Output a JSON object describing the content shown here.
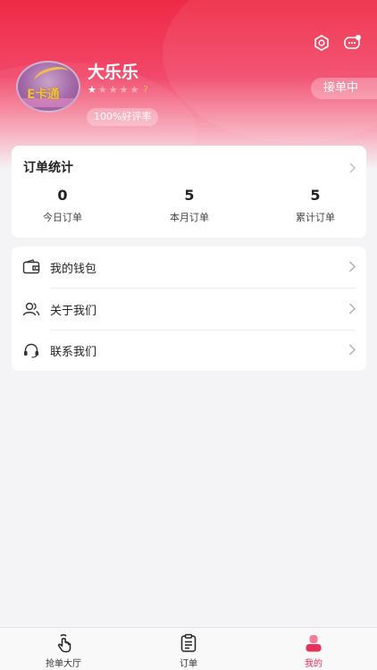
{
  "header": {
    "user_name": "大乐乐",
    "rating": {
      "filled": 1,
      "total": 5,
      "value_label": "?"
    },
    "good_rate_label": "100%好评率",
    "status_label": "接单中",
    "avatar_text": "E卡通"
  },
  "stats": {
    "title": "订单统计",
    "items": [
      {
        "value": "0",
        "label": "今日订单"
      },
      {
        "value": "5",
        "label": "本月订单"
      },
      {
        "value": "5",
        "label": "累计订单"
      }
    ]
  },
  "menu": {
    "items": [
      {
        "label": "我的钱包",
        "icon": "wallet-icon"
      },
      {
        "label": "关于我们",
        "icon": "users-icon"
      },
      {
        "label": "联系我们",
        "icon": "headset-icon"
      }
    ]
  },
  "tabbar": {
    "tabs": [
      {
        "label": "抢单大厅",
        "icon": "hand-tap-icon"
      },
      {
        "label": "订单",
        "icon": "clipboard-icon"
      },
      {
        "label": "我的",
        "icon": "user-icon",
        "active": true
      }
    ],
    "active_color": "#e5325a"
  },
  "colors": {
    "brand": "#ee2a45",
    "star": "#f6c33a"
  }
}
